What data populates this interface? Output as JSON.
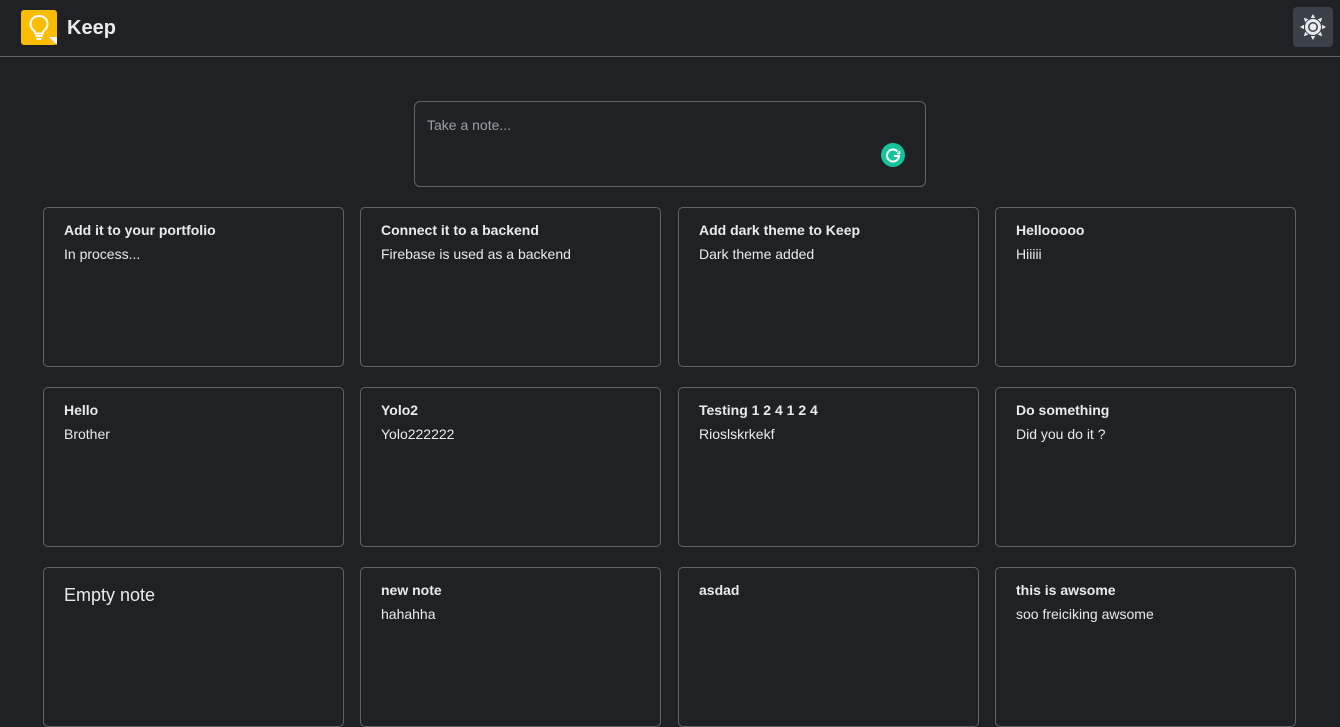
{
  "header": {
    "app_title": "Keep",
    "logo_icon": "lightbulb-icon",
    "theme_toggle_icon": "sun-icon",
    "accent_color": "#fbbc04"
  },
  "composer": {
    "placeholder": "Take a note...",
    "extension_icon": "grammarly-icon"
  },
  "notes": [
    {
      "title": "Add it to your portfolio",
      "content": "In process..."
    },
    {
      "title": "Connect it to a backend",
      "content": "Firebase is used as a backend"
    },
    {
      "title": "Add dark theme to Keep",
      "content": "Dark theme added"
    },
    {
      "title": "Hellooooo",
      "content": "Hiiiii"
    },
    {
      "title": "Hello",
      "content": "Brother"
    },
    {
      "title": "Yolo2",
      "content": "Yolo222222"
    },
    {
      "title": "Testing 1 2 4 1 2 4",
      "content": "Rioslskrkekf"
    },
    {
      "title": "Do something",
      "content": "Did you do it ?"
    },
    {
      "title": "",
      "content": "",
      "placeholder": "Empty note"
    },
    {
      "title": "new note",
      "content": "hahahha"
    },
    {
      "title": "asdad",
      "content": ""
    },
    {
      "title": "this is awsome",
      "content": "soo freiciking awsome"
    }
  ]
}
